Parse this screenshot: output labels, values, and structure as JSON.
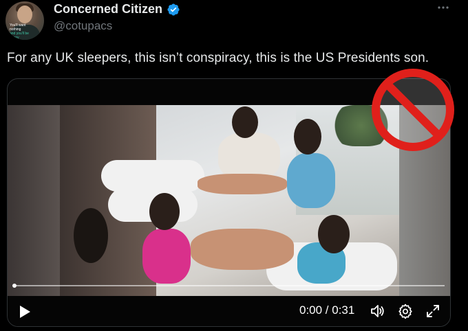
{
  "author": {
    "display_name": "Concerned Citizen",
    "handle": "@cotupacs",
    "verified": true,
    "avatar_caption_line1": "You'll want nothing",
    "avatar_caption_line2": "and you'll be happy"
  },
  "tweet": {
    "text": "For any UK sleepers, this isn’t conspiracy, this is the US Presidents son."
  },
  "video": {
    "time_display": "0:00 / 0:31",
    "progress": 0.0,
    "duration": "0:31",
    "current_time": "0:00"
  },
  "icons": {
    "verified": "verified-badge-icon",
    "more": "more-horizontal-icon",
    "play": "play-icon",
    "volume": "volume-icon",
    "settings": "gear-icon",
    "fullscreen": "expand-icon",
    "overlay": "prohibition-sign-icon"
  },
  "colors": {
    "background": "#000000",
    "text_primary": "#e7e9ea",
    "text_secondary": "#71767b",
    "verified_blue": "#1d9bf0",
    "prohibit_red": "#e0201b"
  }
}
